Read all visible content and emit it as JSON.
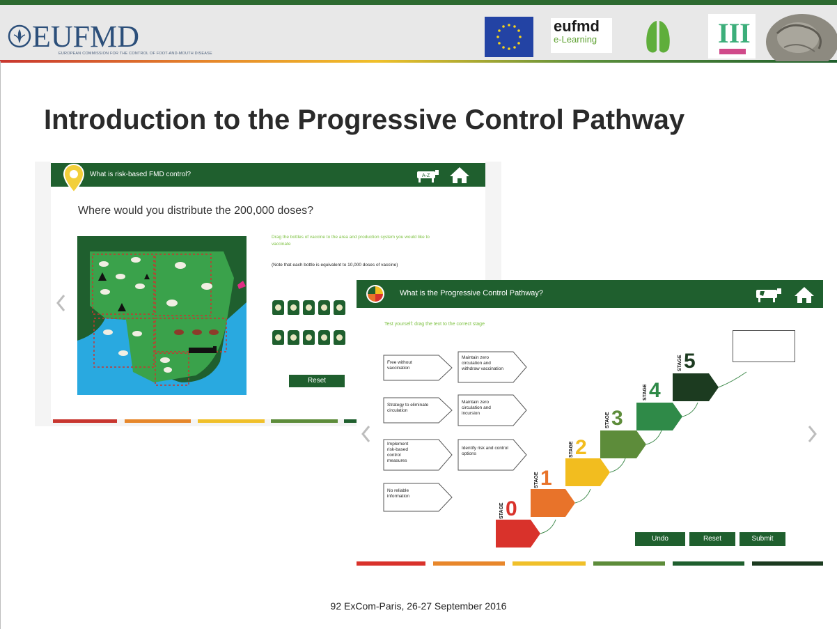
{
  "header": {
    "org_logo_text": "EUFMD",
    "org_subtitle": "EUROPEAN COMMISSION FOR THE CONTROL OF FOOT-AND-MOUTH DISEASE",
    "elearning_line1": "eufmd",
    "elearning_line2": "e-Learning",
    "badge_iii": "III"
  },
  "slide": {
    "title": "Introduction to the Progressive Control Pathway",
    "footer": "92 ExCom-Paris, 26-27 September 2016"
  },
  "screen1": {
    "header_title": "What is risk-based FMD control?",
    "question": "Where would you distribute the 200,000 doses?",
    "instruction_green": "Drag the bottles of vaccine to the area and production system you would like to vaccinate",
    "instruction_note": "(Note that each bottle is equivalent to 10,000 doses of vaccine)",
    "reset_label": "Reset"
  },
  "screen2": {
    "header_title": "What is the Progressive Control Pathway?",
    "instruction": "Test yourself: drag the text to the correct stage",
    "cards_left": [
      "Free without vaccination",
      "Strategy to eliminate circulation",
      "Implement risk-based control measures",
      "No reliable information"
    ],
    "cards_right": [
      "Maintain zero circulation and withdraw vaccination",
      "Maintain zero circulation and incursion",
      "Identify risk and control options"
    ],
    "stage_word": "STAGE",
    "stages": [
      "0",
      "1",
      "2",
      "3",
      "4",
      "5"
    ],
    "undo_label": "Undo",
    "reset_label": "Reset",
    "submit_label": "Submit"
  },
  "colors": {
    "brand_green": "#1f5f2e",
    "stage_0": "#d9322b",
    "stage_1": "#e8732a",
    "stage_2": "#f2bd1f",
    "stage_3": "#5d8c3a",
    "stage_4": "#2f8a48",
    "stage_5": "#1c3b20"
  }
}
